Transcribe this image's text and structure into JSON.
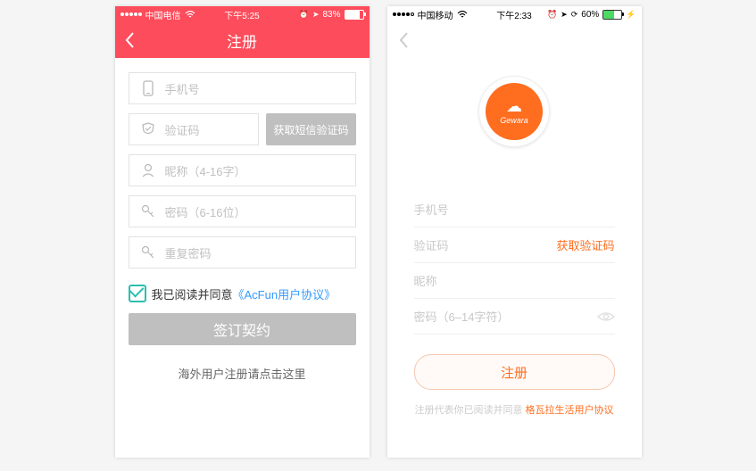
{
  "phoneA": {
    "status": {
      "carrier": "中国电信",
      "time": "下午5:25",
      "battery_pct": "83%"
    },
    "header": {
      "title": "注册"
    },
    "fields": {
      "phone": {
        "placeholder": "手机号"
      },
      "code": {
        "placeholder": "验证码"
      },
      "sms_btn": "获取短信验证码",
      "nick": {
        "placeholder": "昵称（4-16字）"
      },
      "pwd": {
        "placeholder": "密码（6-16位）"
      },
      "pwd2": {
        "placeholder": "重复密码"
      }
    },
    "agree": {
      "prefix": "我已阅读并同意",
      "link": "《AcFun用户协议》"
    },
    "submit": "签订契约",
    "overseas": "海外用户注册请点击这里"
  },
  "phoneB": {
    "status": {
      "carrier": "中国移动",
      "time": "下午2:33",
      "battery_pct": "60%"
    },
    "logo": {
      "name": "Gewara"
    },
    "fields": {
      "phone": {
        "label": "手机号"
      },
      "code": {
        "label": "验证码",
        "get": "获取验证码"
      },
      "nick": {
        "label": "昵称"
      },
      "pwd": {
        "label": "密码（6–14字符）"
      }
    },
    "submit": "注册",
    "disclaimer": {
      "prefix": "注册代表你已阅读并同意",
      "link": "格瓦拉生活用户协议"
    }
  }
}
